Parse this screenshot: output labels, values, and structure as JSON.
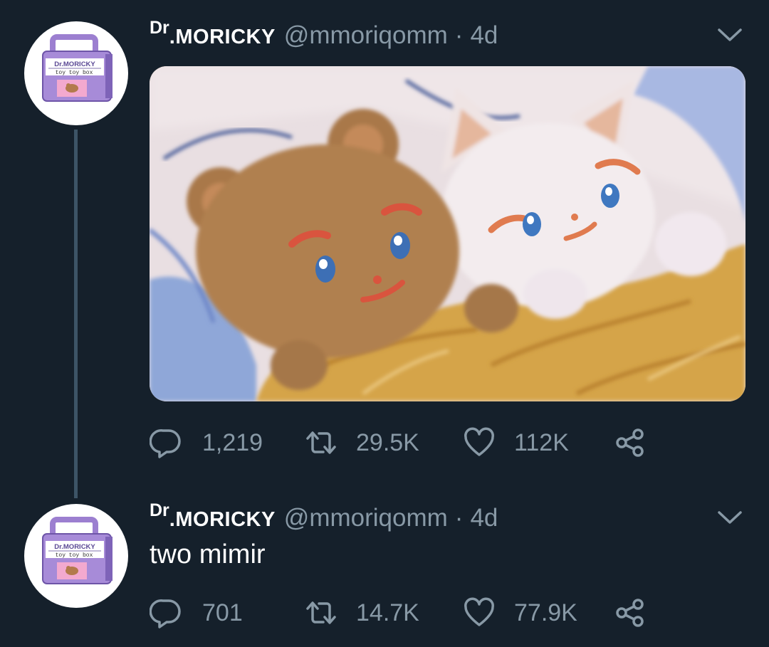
{
  "tweets": [
    {
      "author": {
        "name_prefix": "Dr",
        "name": ".MORICKY",
        "handle": "@mmoriqomm",
        "avatar_text_top": "Dr.MORICKY",
        "avatar_text_bottom": "toy toy box"
      },
      "time": "4d",
      "separator": "·",
      "text": "",
      "has_media": true,
      "media_alt": "painted illustration of a brown teddy bear and a white cat plush lying in bed under a yellow blanket",
      "stats": {
        "replies": "1,219",
        "retweets": "29.5K",
        "likes": "112K"
      }
    },
    {
      "author": {
        "name_prefix": "Dr",
        "name": ".MORICKY",
        "handle": "@mmoriqomm",
        "avatar_text_top": "Dr.MORICKY",
        "avatar_text_bottom": "toy toy box"
      },
      "time": "4d",
      "separator": "·",
      "text": "two mimir",
      "has_media": false,
      "stats": {
        "replies": "701",
        "retweets": "14.7K",
        "likes": "77.9K"
      }
    }
  ],
  "icons": {
    "reply": "reply-icon",
    "retweet": "retweet-icon",
    "like": "heart-icon",
    "share": "share-icon",
    "menu": "chevron-down-icon"
  },
  "colors": {
    "background": "#15202b",
    "text_primary": "#ffffff",
    "text_secondary": "#8899a6",
    "thread_line": "#3d5466",
    "avatar_box": "#9c7fd0"
  }
}
